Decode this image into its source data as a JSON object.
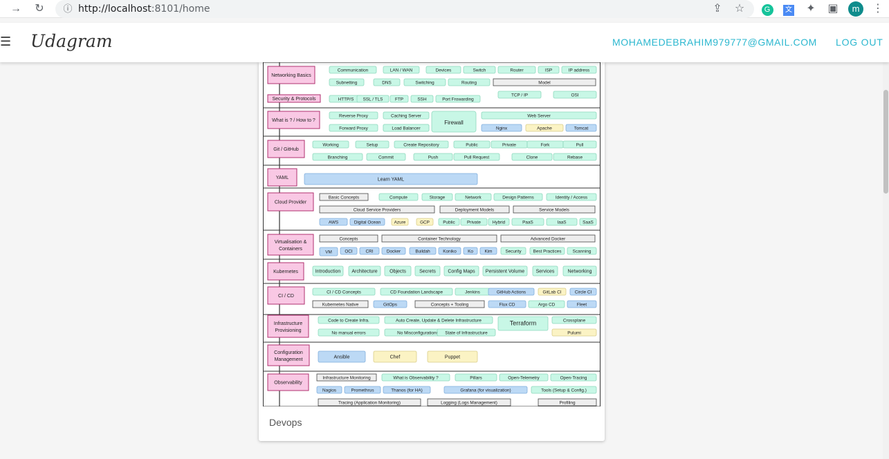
{
  "browser": {
    "url_host": "http://localhost",
    "url_rest": ":8101/home",
    "profile_initial": "m"
  },
  "app": {
    "brand": "Udagram",
    "email": "MOHAMEDEBRAHIM979777@GMAIL.COM",
    "logout_label": "LOG OUT"
  },
  "card": {
    "caption": "Devops"
  },
  "roadmap": {
    "sections": [
      {
        "title": "Networking Basics"
      },
      {
        "title": "Security & Protocols"
      },
      {
        "title": "What is ? / How to ?"
      },
      {
        "title": "Git / GitHub"
      },
      {
        "title": "YAML"
      },
      {
        "title": "Cloud Provider"
      },
      {
        "title": "Virtualisation & Containers"
      },
      {
        "title": "Kubernetes"
      },
      {
        "title": "CI / CD"
      },
      {
        "title": "Infrastructure Provisioning"
      },
      {
        "title": "Configuration Management"
      },
      {
        "title": "Observability"
      }
    ],
    "chips": [
      "Communication",
      "LAN / WAN",
      "Devices",
      "Switch",
      "Router",
      "ISP",
      "IP address",
      "Subnetting",
      "DNS",
      "Switching",
      "Routing",
      "Model",
      "TCP / IP",
      "OSI",
      "HTTP/S",
      "SSL / TLS",
      "FTP",
      "SSH",
      "Port Frowarding",
      "Reverse Proxy",
      "Caching Server",
      "Firewall",
      "Web Server",
      "Forward Proxy",
      "Load Balancer",
      "Nginx",
      "Apache",
      "Tomcat",
      "Working",
      "Setup",
      "Create Repository",
      "Public",
      "Private",
      "Fork",
      "Pull",
      "Branching",
      "Commit",
      "Push",
      "Pull Request",
      "Clone",
      "Rebase",
      "Learn YAML",
      "Basic Concepts",
      "Compute",
      "Storage",
      "Network",
      "Design Patterns",
      "Identity / Access",
      "Cloud Service Providers",
      "Deployment Models",
      "Service Models",
      "AWS",
      "Digital Ocean",
      "Azure",
      "GCP",
      "Public",
      "Private",
      "Hybrid",
      "PaaS",
      "IaaS",
      "SaaS",
      "Concepts",
      "Container Technology",
      "Advanced Docker",
      "VM",
      "OCI",
      "CRI",
      "Docker",
      "Buildah",
      "Koniko",
      "Ko",
      "Kim",
      "Security",
      "Best Practices",
      "Scanning",
      "Introduction",
      "Architecture",
      "Objects",
      "Secrets",
      "Config Maps",
      "Persistent Volume",
      "Services",
      "Networking",
      "CI / CD Concepts",
      "CD Foundation Landscape",
      "Jenkins",
      "GitHub Actions",
      "GitLab CI",
      "Circle CI",
      "Kubernetes Native",
      "GitOps",
      "Concepts + Tooling",
      "Flux CD",
      "Argo CD",
      "Fleet",
      "Code to Create Infra.",
      "Auto Create, Update & Delete Infrastructure",
      "Terraform",
      "Crossplane",
      "No manual errors",
      "No Misconfigurations",
      "State of Infrastructure",
      "Pulumi",
      "Ansible",
      "Chef",
      "Puppet",
      "Infrastructure Monitoring",
      "What is Observability ?",
      "Pillars",
      "Open-Telemetry",
      "Open-Tracing",
      "Nagios",
      "Promethrus",
      "Thanos (for HA)",
      "Grafana (for visualization)",
      "Tools (Setup & Config.)",
      "Tracing (Application Monitoring)",
      "Logging (Logs Management)",
      "Profiling"
    ]
  },
  "colors": {
    "accent": "#2bb7cf",
    "section_fill": "#f9c8e4",
    "section_border": "#b0306f",
    "chip_fill": "#c8f7e6",
    "group_fill": "#eeeeee",
    "blue_chip": "#bcd9f5",
    "yellow_chip": "#fbf3c4"
  },
  "icons": [
    "forward-icon",
    "reload-icon",
    "info-icon",
    "share-icon",
    "star-icon",
    "grammarly-icon",
    "translate-icon",
    "extensions-icon",
    "sidepanel-icon",
    "menu-dots-icon",
    "hamburger-icon"
  ]
}
